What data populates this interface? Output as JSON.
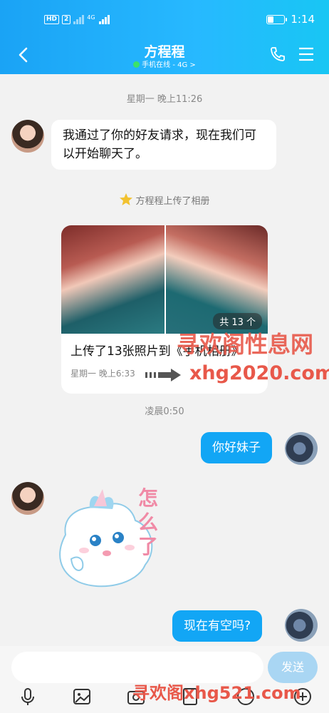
{
  "status_bar": {
    "hd_label": "HD",
    "sim_label": "2",
    "network_label": "4G",
    "time": "1:14"
  },
  "header": {
    "title": "方程程",
    "subtitle": "手机在线 - 4G >"
  },
  "messages": {
    "time1": "星期一 晚上11:26",
    "m1": "我通过了你的好友请求，现在我们可以开始聊天了。",
    "album_notice": "方程程上传了相册",
    "album_count": "共 13 个",
    "album_caption": "上传了13张照片到《手机相册》",
    "album_time": "星期一 晚上6:33",
    "time2": "凌晨0:50",
    "m2": "你好妹子",
    "sticker_text": "怎么了",
    "m3": "现在有空吗?"
  },
  "watermarks": {
    "wm1": "寻欢阁性息网",
    "wm2": "xhg2020.com",
    "wm3": "寻欢阁xhg521.com"
  },
  "input_bar": {
    "send_label": "发送"
  },
  "colors": {
    "header_gradient_start": "#1aa3f5",
    "bubble_out": "#12a6f5",
    "send_btn": "#a9d6f3",
    "online_dot": "#3ce26a"
  }
}
